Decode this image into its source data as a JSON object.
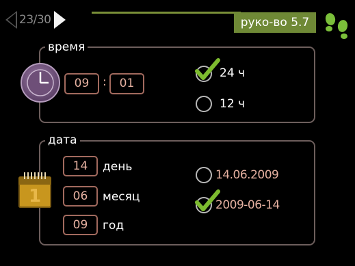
{
  "header": {
    "page_counter": "23/30",
    "menu_label": "руко-во 5.7"
  },
  "time_section": {
    "title": "время",
    "hour": "09",
    "separator": ":",
    "minute": "01",
    "format_options": [
      {
        "label": "24 ч",
        "selected": true
      },
      {
        "label": "12 ч",
        "selected": false
      }
    ]
  },
  "date_section": {
    "title": "дата",
    "calendar_icon_text": "1",
    "fields": [
      {
        "value": "14",
        "label": "день"
      },
      {
        "value": "06",
        "label": "месяц"
      },
      {
        "value": "09",
        "label": "год"
      }
    ],
    "format_options": [
      {
        "label": "14.06.2009",
        "selected": false
      },
      {
        "label": "2009-06-14",
        "selected": true
      }
    ]
  },
  "colors": {
    "accent_green": "#6f8936",
    "field_border": "#a26a5e",
    "field_text": "#e5b0a0",
    "frame_border": "#6d5e5c"
  }
}
